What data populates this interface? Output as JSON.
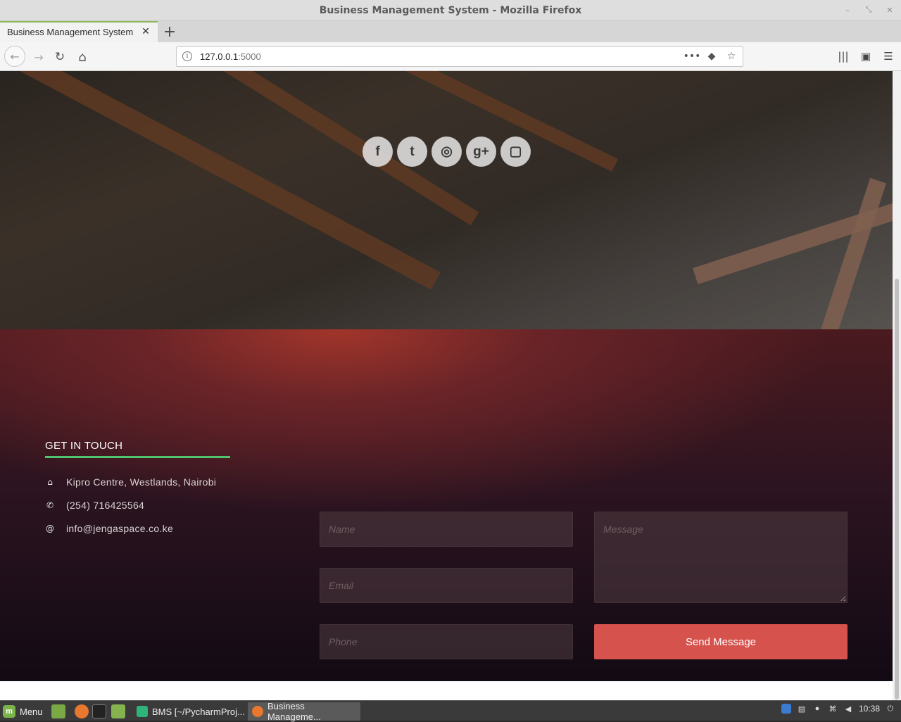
{
  "window": {
    "title": "Business Management System - Mozilla Firefox",
    "controls": {
      "minimize": "–",
      "restore": "⤡",
      "close": "✕"
    }
  },
  "tabs": [
    {
      "label": "Business Management System",
      "close": "✕",
      "active": true
    }
  ],
  "new_tab": "+",
  "nav": {
    "back": "←",
    "forward": "→",
    "reload": "↻",
    "home": "⌂",
    "url_host": "127.0.0.1",
    "url_port": ":5000",
    "info": "i",
    "page_actions": "•••",
    "pocket": "◆",
    "bookmark": "☆",
    "library": "|||",
    "sidebar": "▣",
    "menu": "☰"
  },
  "hero": {
    "social": [
      {
        "name": "facebook",
        "glyph": "f"
      },
      {
        "name": "twitter",
        "glyph": "t"
      },
      {
        "name": "dribbble",
        "glyph": "◎"
      },
      {
        "name": "google-plus",
        "glyph": "g+"
      },
      {
        "name": "instagram",
        "glyph": "▢"
      }
    ]
  },
  "contact": {
    "heading": "GET IN TOUCH",
    "address_icon": "⌂",
    "address": "Kipro Centre, Westlands, Nairobi",
    "phone_icon": "✆",
    "phone": "(254) 716425564",
    "email_icon": "@",
    "email": "info@jengaspace.co.ke",
    "form": {
      "name_placeholder": "Name",
      "email_placeholder": "Email",
      "phone_placeholder": "Phone",
      "message_placeholder": "Message",
      "submit_label": "Send Message"
    },
    "accent_color": "#4fc36d",
    "button_color": "#d5524d"
  },
  "taskbar": {
    "menu_label": "Menu",
    "menu_glyph": "m",
    "tasks": [
      {
        "label": "BMS [~/PycharmProj...",
        "active": false
      },
      {
        "label": "Business Manageme...",
        "active": true
      }
    ],
    "clock": "10:38"
  }
}
